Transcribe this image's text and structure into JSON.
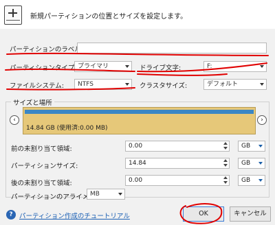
{
  "header": {
    "icon": "add-partition-icon",
    "title": "新規パーティションの位置とサイズを設定します。"
  },
  "form": {
    "partition_label": {
      "label": "パーティションのラベル:",
      "value": ""
    },
    "partition_type": {
      "label": "パーティションタイプ:",
      "value": "プライマリ"
    },
    "drive_letter": {
      "label": "ドライブ文字:",
      "value": "F:"
    },
    "file_system": {
      "label": "ファイルシステム:",
      "value": "NTFS"
    },
    "cluster_size": {
      "label": "クラスタサイズ:",
      "value": "デフォルト"
    }
  },
  "size_location": {
    "group_title": "サイズと場所",
    "disk_bar_text": "14.84 GB (使用済:0.00 MB)",
    "unallocated_before": {
      "label": "前の未割り当て領域:",
      "value": "0.00",
      "unit": "GB"
    },
    "partition_size": {
      "label": "パーティションサイズ:",
      "value": "14.84",
      "unit": "GB"
    },
    "unallocated_after": {
      "label": "後の未割り当て領域:",
      "value": "0.00",
      "unit": "GB"
    },
    "alignment": {
      "label": "パーティションのアライメント:",
      "value": "MB"
    }
  },
  "footer": {
    "help_link": "パーティション作成のチュートリアル",
    "ok": "OK",
    "cancel": "キャンセル"
  },
  "colors": {
    "disk_bar": "#e6c879",
    "used_bar": "#3a87c5",
    "annotation": "#e00000",
    "link": "#1a5fb4"
  }
}
